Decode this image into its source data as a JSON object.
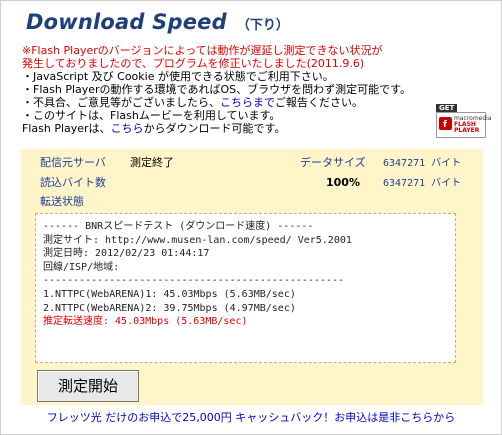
{
  "header": {
    "title": "Download Speed",
    "subtitle": "（下り）"
  },
  "notice": {
    "red_line1": "※Flash Playerのバージョンによっては動作が遅延し測定できない状況が",
    "red_line2": "発生しておりましたので、プログラムを修正いたしました(2011.9.6)",
    "item1": "・JavaScript 及び Cookie が使用できる状態でご利用下さい。",
    "item2": "・Flash Playerの動作する環境であればOS、ブラウザを問わず測定可能です。",
    "item3_pre": "・不具合、ご意見等がございましたら、",
    "item3_link": "こちらまで",
    "item3_post": "ご報告ください。",
    "item4": "・このサイトは、Flashムービーを利用しています。",
    "item5_pre": "Flash Playerは、",
    "item5_link": "こちら",
    "item5_post": "からダウンロード可能です。"
  },
  "flash_badge": {
    "get": "GET",
    "line1": "macromedia",
    "line2": "FLASH",
    "line3": "PLAYER"
  },
  "panel": {
    "server_label": "配信元サーバ",
    "server_value": "測定終了",
    "datasize_label": "データサイズ",
    "datasize_value": "6347271 バイト",
    "read_label": "読込バイト数",
    "read_percent": "100%",
    "read_value": "6347271 バイト",
    "transfer_label": "転送状態"
  },
  "result_lines": [
    "------ BNRスピードテスト (ダウンロード速度) ------",
    "測定サイト: http://www.musen-lan.com/speed/ Ver5.2001",
    "測定日時: 2012/02/23 01:44:17",
    "回線/ISP/地域:",
    "--------------------------------------------------",
    "1.NTTPC(WebARENA)1: 45.03Mbps (5.63MB/sec)",
    "2.NTTPC(WebARENA)2: 39.75Mbps (4.97MB/sec)",
    "推定転送速度: 45.03Mbps (5.63MB/sec)"
  ],
  "start_button": "測定開始",
  "footer": "フレッツ光 だけのお申込で25,000円 キャッシュバック！お申込は是非こちらから",
  "colors": {
    "accent": "#1d3f7a",
    "warning": "#e00000",
    "panel_bg": "#fff5c8",
    "link": "#0000cc"
  }
}
